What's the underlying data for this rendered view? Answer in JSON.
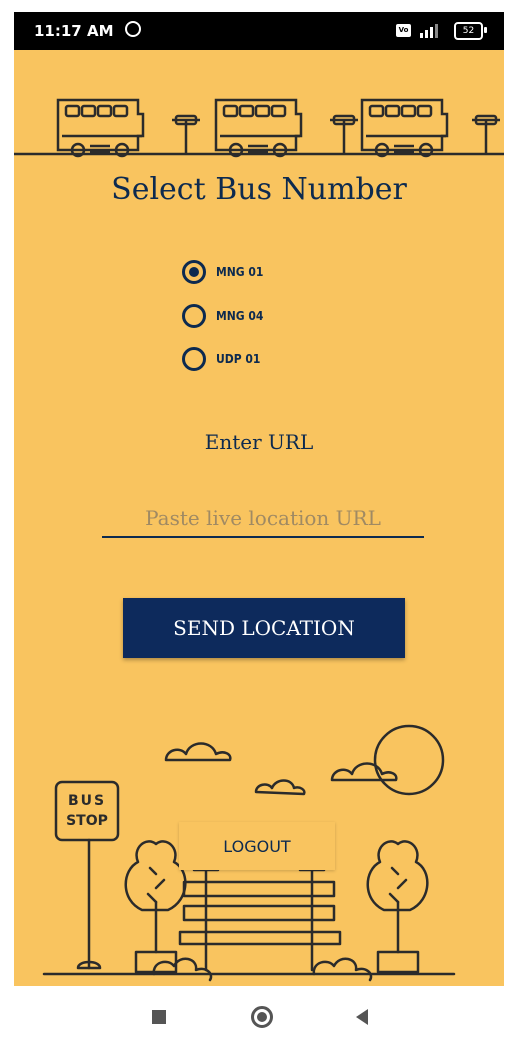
{
  "status_bar": {
    "time": "11:17 AM",
    "network_badge": "Vo LTE",
    "battery": "52",
    "icons": [
      "alarm-icon",
      "volte-icon",
      "signal-icon",
      "battery-icon"
    ]
  },
  "header": {
    "title": "Select Bus Number"
  },
  "bus_options": [
    {
      "label": "MNG 01",
      "selected": true
    },
    {
      "label": "MNG 04",
      "selected": false
    },
    {
      "label": "UDP 01",
      "selected": false
    }
  ],
  "url_section": {
    "label": "Enter URL",
    "placeholder": "Paste live location URL",
    "value": ""
  },
  "buttons": {
    "send_label": "SEND LOCATION",
    "logout_label": "LOGOUT"
  },
  "illustration": {
    "bus_stop_sign": "BUS STOP"
  },
  "nav_bar": {
    "icons": [
      "recents-icon",
      "home-icon",
      "back-icon"
    ]
  },
  "colors": {
    "background": "#f9c45f",
    "primary": "#0d2a5c",
    "ink": "#0d2a4f"
  }
}
